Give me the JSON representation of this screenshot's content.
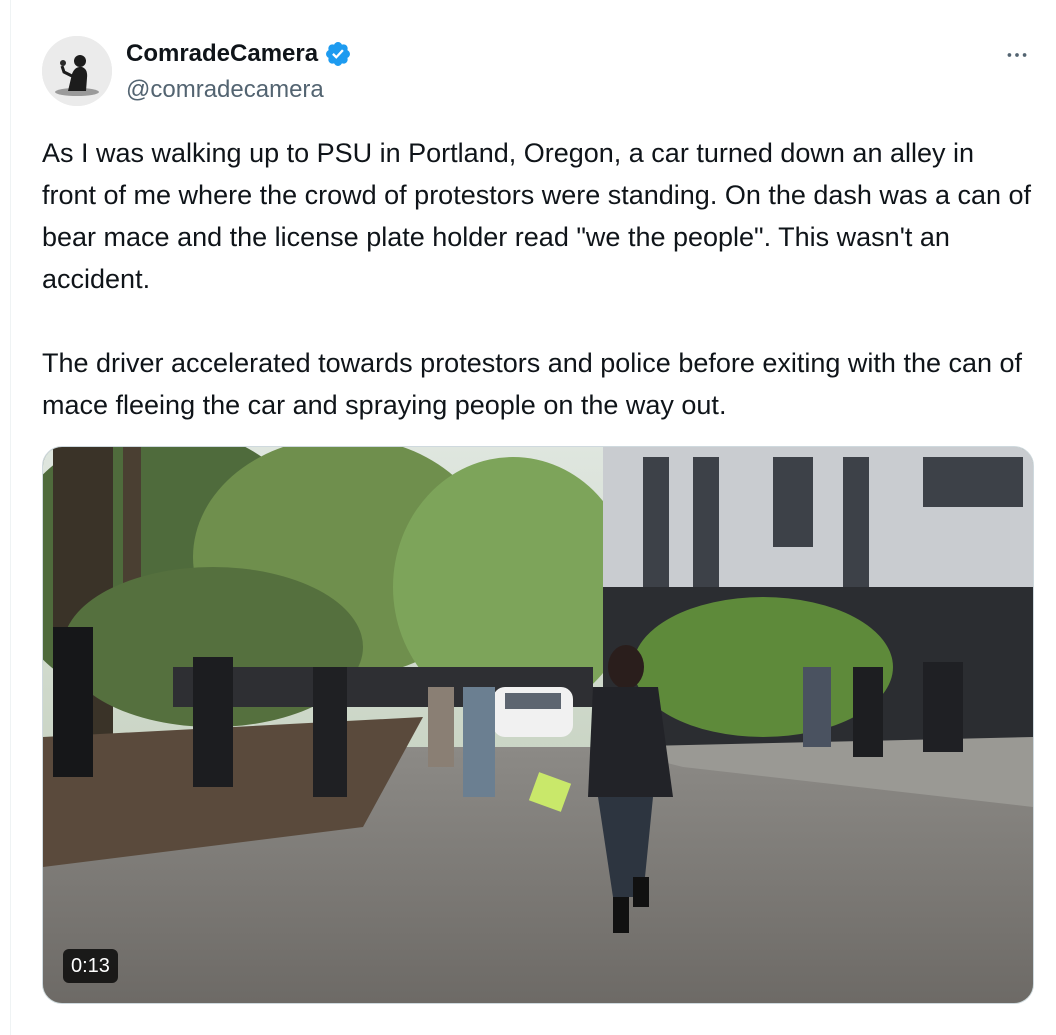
{
  "tweet": {
    "author": {
      "display_name": "ComradeCamera",
      "handle": "@comradecamera",
      "verified": true,
      "verified_color": "#1d9bf0"
    },
    "paragraphs": [
      "As I was walking up to PSU in Portland, Oregon, a car turned down an alley in front of me where the crowd of protestors were standing. On the dash was a can of bear mace and the license plate holder read \"we the people\".  This wasn't an accident.",
      "The driver accelerated towards protestors and police before exiting with the can of mace fleeing the car and spraying people on the way out."
    ],
    "media": {
      "type": "video",
      "duration": "0:13"
    },
    "icons": {
      "more": "more-horizontal-icon",
      "verified": "verified-badge-icon"
    }
  }
}
